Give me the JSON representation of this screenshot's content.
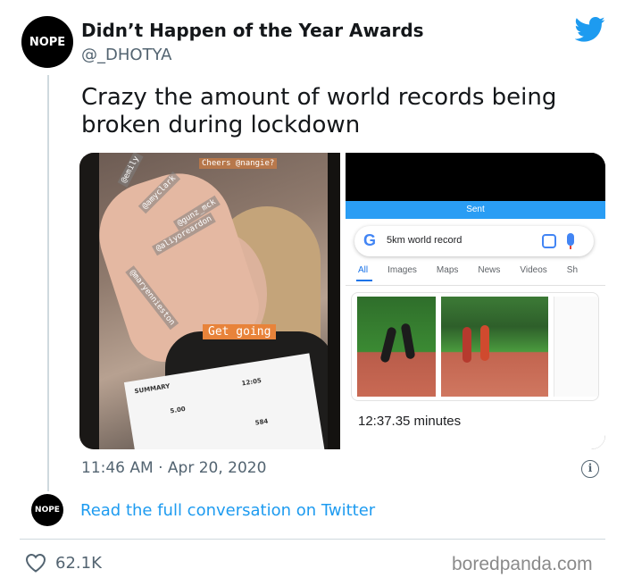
{
  "author": {
    "avatar_text": "NOPE",
    "display_name": "Didn’t Happen of the Year Awards",
    "handle": "@_DHOTYA"
  },
  "tweet": {
    "text": "Crazy the amount of world records being broken during lockdown",
    "timestamp": "11:46 AM · Apr 20, 2020",
    "info_icon": "i"
  },
  "media": {
    "left_photo": {
      "stickers": [
        "@emily",
        "@amyclark",
        "@gunz_mck",
        "@aliyoreardon",
        "@maryennieston",
        "Cheers @nangie?"
      ],
      "get_going": "Get going",
      "summary": {
        "title": "SUMMARY",
        "distance": "5.00",
        "time": "12:05",
        "steps": "584"
      }
    },
    "right_screenshot": {
      "sent_label": "Sent",
      "google_logo": "G",
      "search_query": "5km world record",
      "tabs": [
        "All",
        "Images",
        "Maps",
        "News",
        "Videos",
        "Sh"
      ],
      "result_text": "12:37.35 minutes"
    }
  },
  "conversation": {
    "avatar_text": "NOPE",
    "link_text": "Read the full conversation on Twitter"
  },
  "footer": {
    "like_count": "62.1K",
    "watermark": "boredpanda.com"
  },
  "colors": {
    "twitter_blue": "#1d9bf0",
    "text_primary": "#14171a",
    "text_secondary": "#536471"
  }
}
